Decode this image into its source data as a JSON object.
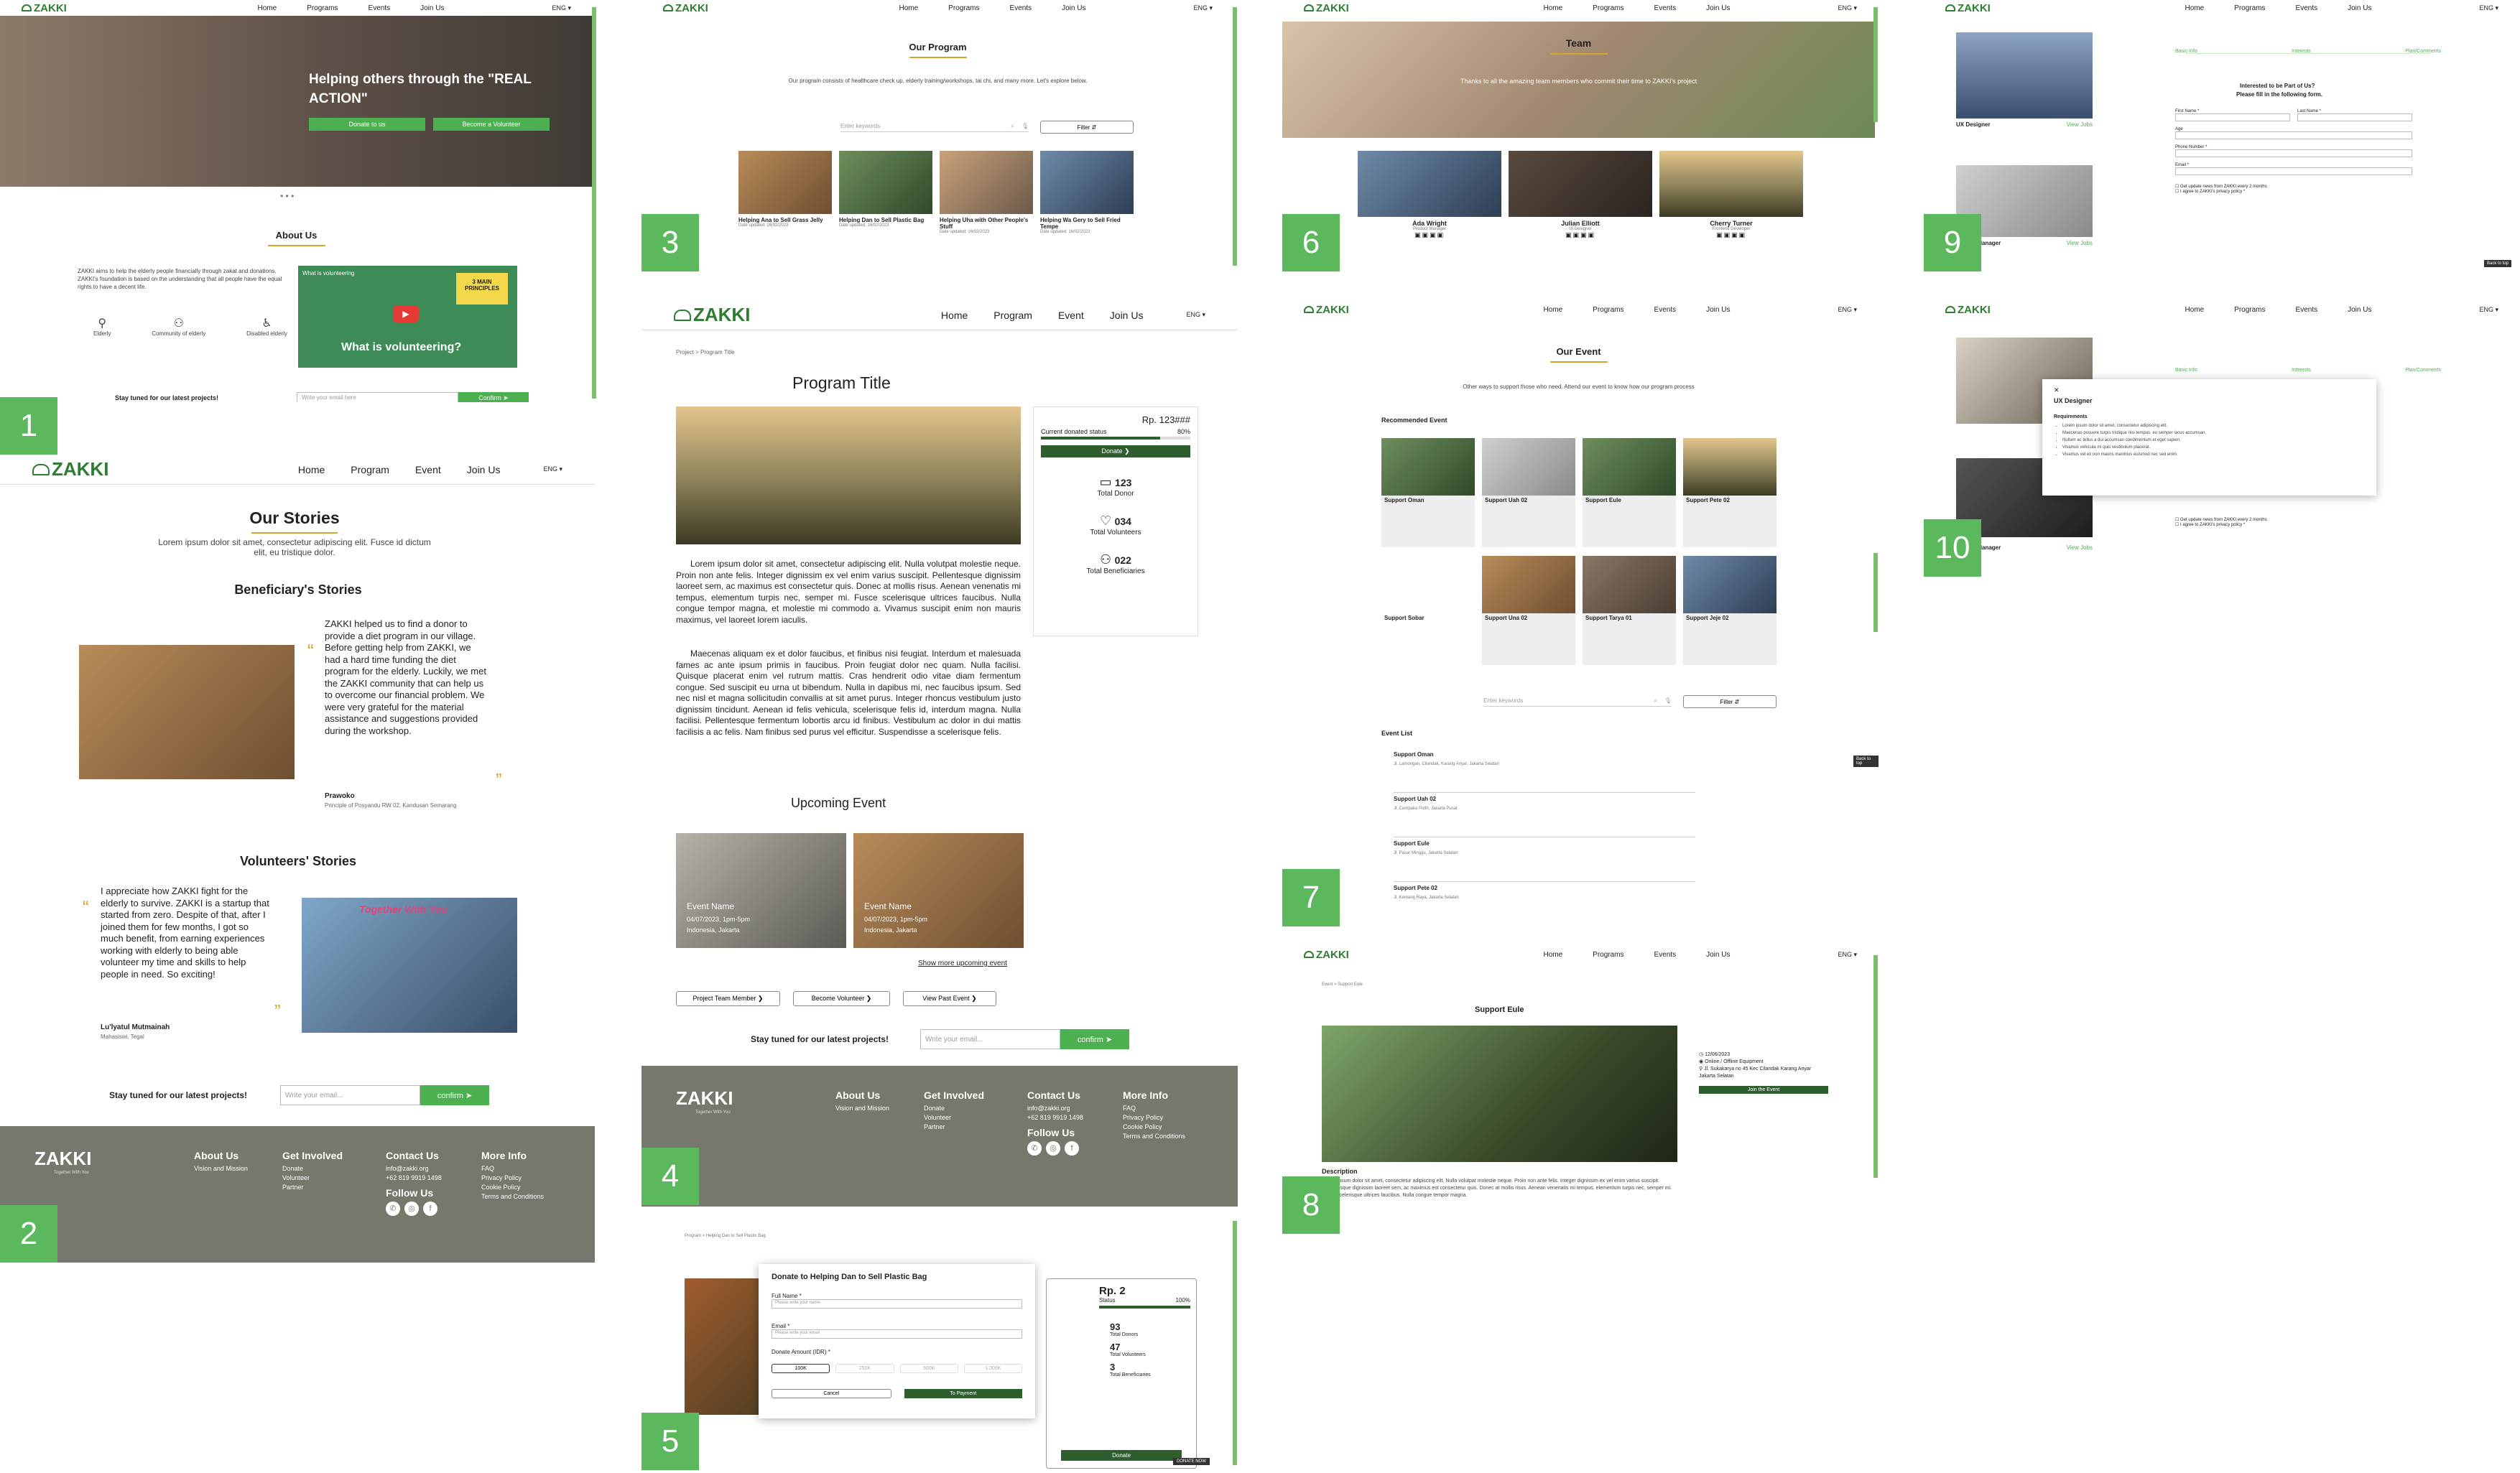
{
  "brand": {
    "name": "ZAKKI",
    "accent": "#4caf50",
    "dark_green": "#2e5e2e",
    "badge_green": "#5cb85c",
    "gold": "#d4a72c",
    "footer_bg": "#78776d"
  },
  "nav": {
    "home": "Home",
    "programs": "Programs",
    "program": "Program",
    "events": "Events",
    "event": "Event",
    "join": "Join Us",
    "lang": "ENG ▾"
  },
  "badges": [
    "1",
    "2",
    "3",
    "4",
    "5",
    "6",
    "7",
    "8",
    "9",
    "10"
  ],
  "p1": {
    "hero_title": "Helping others through the \"REAL ACTION\"",
    "btn_donate": "Donate to us",
    "btn_volunteer": "Become a Volunteer",
    "dots": "• • •",
    "about_title": "About Us",
    "about_text": "ZAKKI aims to help the elderly people financially through zakat and donations. ZAKKI's foundation is based on the understanding that all people have the equal rights to have a decent life.",
    "icons": [
      "Elderly",
      "Community of elderly",
      "Disabled elderly"
    ],
    "video_title": "What is volunteering?",
    "video_caption": "What is volunteering",
    "video_tag": "3 MAIN PRINCIPLES",
    "subscribe_text": "Stay tuned for our latest projects!",
    "email_placeholder": "Write your email here",
    "confirm": "Confirm ➤"
  },
  "p2": {
    "title": "Our Stories",
    "intro": "Lorem ipsum dolor sit amet, consectetur adipiscing elit. Fusce id dictum elit, eu tristique dolor.",
    "beneficiary_title": "Beneficiary's Stories",
    "beneficiary_text": "ZAKKI helped us to find a donor to provide a diet program in our village. Before getting help from ZAKKI, we had a hard time funding the diet program for the elderly. Luckily, we met the ZAKKI community that can help us to overcome our financial problem. We were very grateful for the material assistance and suggestions provided during the workshop.",
    "beneficiary_name": "Prawoko",
    "beneficiary_role": "Principle of Posyandu RW 02, Kandusan Semarang",
    "volunteer_title": "Volunteers' Stories",
    "volunteer_text": "I appreciate how ZAKKI fight for the elderly to survive. ZAKKI is a startup that started from zero. Despite of that, after I joined them for few months, I got so much benefit, from earning experiences working with elderly to being able volunteer my time and skills to help people in need. So exciting!",
    "volunteer_name": "Lu'lyatul Mutmainah",
    "volunteer_role": "Mahasiswi, Tegal",
    "poster_text": "Together With You",
    "subscribe_text": "Stay tuned for our latest projects!",
    "email_placeholder": "Write your email...",
    "confirm": "confirm ➤"
  },
  "footer": {
    "tagline": "Together With You",
    "about": "About Us",
    "about_items": [
      "Vision and Mission"
    ],
    "involved": "Get Involved",
    "involved_items": [
      "Donate",
      "Volunteer",
      "Partner"
    ],
    "contact": "Contact Us",
    "contact_items": [
      "info@zakki.org",
      "+62 819 9919 1498"
    ],
    "follow": "Follow Us",
    "more": "More Info",
    "more_items": [
      "FAQ",
      "Privacy Policy",
      "Cookie Policy",
      "Terms and Conditions"
    ]
  },
  "p3": {
    "title": "Our Program",
    "intro": "Our program consists of healthcare check up, elderly training/workshops, tai chi, and many more. Let's explore below.",
    "search_placeholder": "Enter keywords",
    "filter": "Filter ⇵",
    "cards": [
      {
        "title": "Helping Ana to Sell Grass Jelly",
        "meta": "Date updated: 16/02/2023"
      },
      {
        "title": "Helping Dan to Sell Plastic Bag",
        "meta": "Date updated: 16/02/2023"
      },
      {
        "title": "Helping Uha with Other People's Stuff",
        "meta": "Date updated: 16/02/2023"
      },
      {
        "title": "Helping Wa Gery to Sell Fried Tempe",
        "meta": "Date updated: 16/02/2023"
      }
    ]
  },
  "p4": {
    "breadcrumb": "Project > Program Title",
    "title": "Program Title",
    "amount": "Rp. 123###",
    "status_label": "Current donated status",
    "status_pct": "80%",
    "donate": "Donate ❯",
    "stats": [
      {
        "value": "123",
        "label": "Total Donor",
        "icon": "wallet-icon"
      },
      {
        "value": "034",
        "label": "Total Volunteers",
        "icon": "heart-hand-icon"
      },
      {
        "value": "022",
        "label": "Total Beneficiaries",
        "icon": "people-icon"
      }
    ],
    "para1": "Lorem ipsum dolor sit amet, consectetur adipiscing elit. Nulla volutpat molestie neque. Proin non ante felis. Integer dignissim ex vel enim varius suscipit. Pellentesque dignissim laoreet sem, ac maximus est consectetur quis. Donec at mollis risus. Aenean venenatis mi tempus, elementum turpis nec, semper mi. Fusce scelerisque ultrices faucibus. Nulla congue tempor magna, et molestie mi commodo a. Vivamus suscipit enim non mauris maximus, vel laoreet lorem iaculis.",
    "para2": "Maecenas aliquam ex et dolor faucibus, et finibus nisi feugiat. Interdum et malesuada fames ac ante ipsum primis in faucibus. Proin feugiat dolor nec quam. Nulla facilisi. Quisque placerat enim vel rutrum mattis. Cras hendrerit odio vitae diam fermentum congue. Sed suscipit eu urna ut bibendum. Nulla in dapibus mi, nec faucibus ipsum. Sed nec nisl et magna sollicitudin convallis at sit amet purus. Integer rhoncus vestibulum justo dignissim tincidunt. Aenean id felis vehicula, scelerisque felis id, interdum magna. Nulla facilisi. Pellentesque fermentum lobortis arcu id finibus. Vestibulum ac dolor in dui mattis facilisis a ac felis. Nam finibus sed purus vel efficitur. Suspendisse a scelerisque felis.",
    "upcoming_title": "Upcoming Event",
    "events": [
      {
        "name": "Event Name",
        "date": "04/07/2023, 1pm-5pm",
        "place": "Indonesia, Jakarta"
      },
      {
        "name": "Event Name",
        "date": "04/07/2023, 1pm-5pm",
        "place": "Indonesia, Jakarta"
      }
    ],
    "show_more": "Show more upcoming event",
    "buttons": [
      "Project Team Member ❯",
      "Become Volunteer ❯",
      "View Past Event ❯"
    ],
    "subscribe_text": "Stay tuned for our latest projects!",
    "email_placeholder": "Write your email...",
    "confirm": "confirm ➤"
  },
  "p5": {
    "breadcrumb": "Program > Helping Dan to Sell Plastic Bag",
    "modal_title": "Donate to Helping Dan to Sell Plastic Bag",
    "full_name": "Full Name *",
    "full_name_ph": "Please write your name",
    "email": "Email *",
    "email_ph": "Please write your email",
    "amount_label": "Donate Amount (IDR) *",
    "amounts": [
      "100K",
      "250K",
      "500K",
      "1.000K"
    ],
    "cancel": "Cancel",
    "pay": "To Payment",
    "rp": "Rp. 2",
    "status": "Status",
    "pct": "100%",
    "stats": [
      "93",
      "47",
      "3"
    ],
    "stat_labels": [
      "Total Donors",
      "Total Volunteers",
      "Total Beneficiaries"
    ],
    "donate": "Donate",
    "chip": "DONATE NOW"
  },
  "p6": {
    "title": "Team",
    "intro": "Thanks to all the amazing team members who commit their time to ZAKKI's project",
    "members": [
      {
        "name": "Ada Wright",
        "role": "Product Manager"
      },
      {
        "name": "Julian Elliott",
        "role": "UI Designer"
      },
      {
        "name": "Cherry Turner",
        "role": "Frontend Developer"
      }
    ]
  },
  "p7": {
    "title": "Our Event",
    "intro": "Other ways to support those who need. Attend our event to know how our program process",
    "recommended": "Recommended Event",
    "events": [
      {
        "name": "Support Oman"
      },
      {
        "name": "Support Uah 02"
      },
      {
        "name": "Support Eule"
      },
      {
        "name": "Support Pete 02"
      },
      {
        "name": "Support Sobar"
      },
      {
        "name": "Support Una 02"
      },
      {
        "name": "Support Tarya 01"
      },
      {
        "name": "Support Jeje 02"
      }
    ],
    "search_placeholder": "Enter keywords",
    "filter": "Filter ⇵",
    "list_title": "Event List",
    "list": [
      {
        "name": "Support Oman",
        "loc": "Jl. Lamongan, Cilandak, Karang Anyar, Jakarta Selatan"
      },
      {
        "name": "Support Uah 02",
        "loc": "Jl. Cempaka Putih, Jakarta Pusat"
      },
      {
        "name": "Support Eule",
        "loc": "Jl. Pasar Minggu, Jakarta Selatan"
      },
      {
        "name": "Support Pete 02",
        "loc": "Jl. Kemang Raya, Jakarta Selatan"
      }
    ],
    "chip": "Back to top"
  },
  "p8": {
    "breadcrumb": "Event > Support Eule",
    "title": "Support Eule",
    "date": "12/06/2023",
    "mode": "Online / Offline Equipment",
    "detail": "Jl. Sukakarya no 45 Kec Cilandak Karang Anyar Jakarta Selatan",
    "register": "Join the Event",
    "desc_title": "Description",
    "desc": "Lorem ipsum dolor sit amet, consectetur adipiscing elit. Nulla volutpat molestie neque. Proin non ante felis. Integer dignissim ex vel enim varius suscipit. Pellentesque dignissim laoreet sem, ac maximus est consectetur quis. Donec at mollis risus. Aenean venenatis mi tempus, elementum turpis nec, semper mi. Fusce scelerisque ultrices faucibus. Nulla congue tempor magna."
  },
  "p9": {
    "steps": [
      "Basic Info",
      "Interests",
      "Plan/Comments"
    ],
    "jobs": [
      {
        "title": "UX Designer",
        "link": "View Jobs"
      },
      {
        "title": "Project Manager",
        "link": "View Jobs"
      }
    ],
    "form_title": "Interested to be Part of Us?",
    "form_sub": "Please fill in the following form.",
    "first": "First Name *",
    "last": "Last Name *",
    "age": "Age",
    "phone": "Phone Number *",
    "email": "Email *",
    "check1": "Get update news from ZAKKI every 2 months",
    "check2": "I agree to ZAKKI's privacy policy *",
    "chip": "Back to top"
  },
  "p10": {
    "modal_title": "UX Designer",
    "req_title": "Requirements",
    "reqs": [
      "Lorem ipsum dolor sit amet, consectetur adipiscing elit.",
      "Maecenas posuere turpis tristique nisi tempus, eu semper lacus accumsan.",
      "Nullam ac tellus a dui accumsan condimentum et eget sapien.",
      "Vivamus vehicula mi quis vestibulum placerat.",
      "Vivamus vel ex non mauris maximus euismod nec sed enim."
    ],
    "close": "✕",
    "job2": "Project Manager",
    "job2_link": "View Jobs",
    "check1": "Get update news from ZAKKI every 2 months",
    "check2": "I agree to ZAKKI's privacy policy *"
  }
}
